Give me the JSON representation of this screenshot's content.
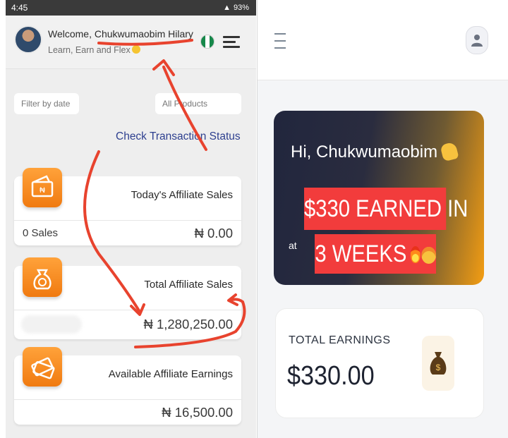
{
  "left_phone": {
    "status_bar": {
      "time": "4:45",
      "battery": "93%"
    },
    "header": {
      "welcome": "Welcome, Chukwumaobim Hilary",
      "tagline": "Learn, Earn and Flex"
    },
    "filters": {
      "date_placeholder": "Filter by date",
      "products_placeholder": "All Products"
    },
    "check_status_link": "Check Transaction Status",
    "cards": [
      {
        "title": "Today's Affiliate Sales",
        "count": "0 Sales",
        "amount": "₦ 0.00"
      },
      {
        "title": "Total Affiliate Sales",
        "amount": "₦ 1,280,250.00"
      },
      {
        "title": "Available Affiliate Earnings",
        "amount": "₦ 16,500.00"
      }
    ]
  },
  "right_phone": {
    "promo": {
      "greeting": "Hi, Chukwumaobim",
      "partial_text": "at",
      "overlay_line1": "$330 EARNED IN",
      "overlay_line2": "3 WEEKS"
    },
    "earnings": {
      "label": "TOTAL EARNINGS",
      "amount": "$330.00"
    }
  },
  "colors": {
    "accent_orange": "#f7891f",
    "link_blue": "#2d3f8f",
    "annotation_red": "#e8432e",
    "overlay_red": "#f23c3c",
    "promo_dark": "#21263d"
  },
  "icons": [
    "wallet-icon",
    "money-bag-icon",
    "cash-icon",
    "menu-icon",
    "user-icon",
    "flag-icon"
  ]
}
